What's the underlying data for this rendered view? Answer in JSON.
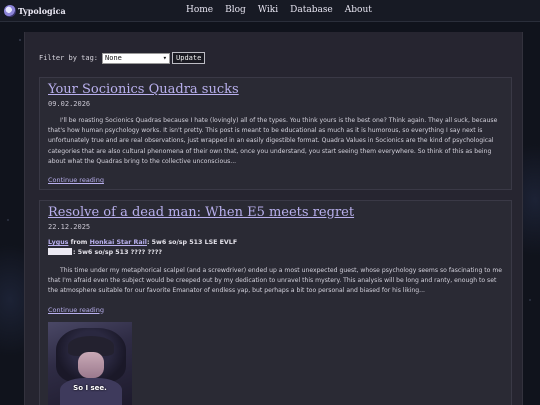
{
  "header": {
    "brand": "Typologica",
    "nav": [
      "Home",
      "Blog",
      "Wiki",
      "Database",
      "About"
    ]
  },
  "filter": {
    "label": "Filter by tag:",
    "selected": "None",
    "button": "Update"
  },
  "posts": [
    {
      "title": "Your Socionics Quadra sucks",
      "date": "09.02.2026",
      "body": "I'll be roasting Socionics Quadras because I hate (lovingly) all of the types. You think yours is the best one? Think again. They all suck, because that's how human psychology works. It isn't pretty. This post is meant to be educational as much as it is humorous, so everything I say next is unfortunately true and are real observations, just wrapped in an easily digestible format. Quadra Values in Socionics are the kind of psychological categories that are also cultural phenomena of their own that, once you understand, you start seeing them everywhere. So think of this as being about what the Quadras bring to the collective unconscious...",
      "continue": "Continue reading"
    },
    {
      "title": "Resolve of a dead man: When E5 meets regret",
      "date": "22.12.2025",
      "meta_author": "Lygus",
      "meta_from": "from",
      "meta_source": "Honkai Star Rail",
      "meta_type1": ": 5w6 so/sp 513 LSE EVLF",
      "meta_type2": ": 5w6 so/sp 513 ???? ????",
      "body": "This time under my metaphorical scalpel (and a screwdriver) ended up a most unexpected guest, whose psychology seems so fascinating to me that I'm afraid even the subject would be creeped out by my dedication to unravel this mystery. This analysis will be long and ranty, enough to set the atmosphere suitable for our favorite Emanator of endless yap, but perhaps a bit too personal and biased for his liking...",
      "continue": "Continue reading",
      "image_caption": "So I see."
    }
  ],
  "colors": {
    "accent": "#b9b0ee",
    "panel": "#262530",
    "card": "#2a2a34"
  }
}
